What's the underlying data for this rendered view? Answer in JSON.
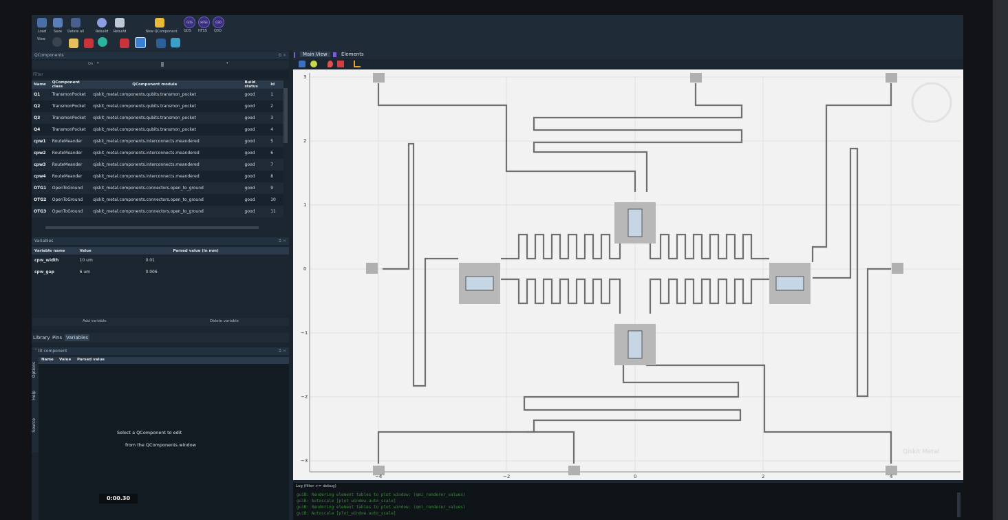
{
  "toolbar": {
    "row1": [
      {
        "label": "Load",
        "icon": "load-icon",
        "color": "#4a6fa8"
      },
      {
        "label": "Save",
        "icon": "save-icon",
        "color": "#5a7fb8"
      },
      {
        "label": "Delete all",
        "icon": "delete-all-icon",
        "color": "#4a5f90"
      },
      {
        "label": "Rebuild",
        "icon": "rebuild-icon",
        "color": "#8a9ee0"
      },
      {
        "label": "Rebuild",
        "icon": "rebuild-all-icon",
        "color": "#c0c8d8"
      },
      {
        "label": "New QComponent",
        "icon": "new-qcomponent-icon",
        "color": "#e8b93a"
      }
    ],
    "round_buttons": [
      "GDS",
      "HFSS",
      "Q3D"
    ],
    "round_labels": [
      "GDS",
      "HFSS",
      "Q3D"
    ],
    "view_label": "View"
  },
  "qcomponents": {
    "title": "QComponents",
    "filter_value": "On",
    "filter_placeholder": "Filter",
    "columns": [
      "Name",
      "QComponent class",
      "QComponent module",
      "Build status",
      "Id"
    ],
    "rows": [
      [
        "Q1",
        "TransmonPocket",
        "qiskit_metal.components.qubits.transmon_pocket",
        "good",
        "1"
      ],
      [
        "Q2",
        "TransmonPocket",
        "qiskit_metal.components.qubits.transmon_pocket",
        "good",
        "2"
      ],
      [
        "Q3",
        "TransmonPocket",
        "qiskit_metal.components.qubits.transmon_pocket",
        "good",
        "3"
      ],
      [
        "Q4",
        "TransmonPocket",
        "qiskit_metal.components.qubits.transmon_pocket",
        "good",
        "4"
      ],
      [
        "cpw1",
        "RouteMeander",
        "qiskit_metal.components.interconnects.meandered",
        "good",
        "5"
      ],
      [
        "cpw2",
        "RouteMeander",
        "qiskit_metal.components.interconnects.meandered",
        "good",
        "6"
      ],
      [
        "cpw3",
        "RouteMeander",
        "qiskit_metal.components.interconnects.meandered",
        "good",
        "7"
      ],
      [
        "cpw4",
        "RouteMeander",
        "qiskit_metal.components.interconnects.meandered",
        "good",
        "8"
      ],
      [
        "OTG1",
        "OpenToGround",
        "qiskit_metal.components.connectors.open_to_ground",
        "good",
        "9"
      ],
      [
        "OTG2",
        "OpenToGround",
        "qiskit_metal.components.connectors.open_to_ground",
        "good",
        "10"
      ],
      [
        "OTG3",
        "OpenToGround",
        "qiskit_metal.components.connectors.open_to_ground",
        "good",
        "11"
      ]
    ]
  },
  "variables": {
    "title": "Variables",
    "columns": [
      "Variable name",
      "Value",
      "Parsed value (in mm)"
    ],
    "rows": [
      [
        "cpw_width",
        "10 um",
        "0.01"
      ],
      [
        "cpw_gap",
        "6 um",
        "0.006"
      ]
    ],
    "add_label": "Add variable",
    "delete_label": "Delete variable"
  },
  "left_tabs": [
    "Library",
    "Pins",
    "Variables"
  ],
  "edit_component": {
    "title": "Edit component",
    "columns": [
      "Name",
      "Value",
      "Parsed value"
    ],
    "message_line1": "Select a QComponent to edit",
    "message_line2": "from the QComponents window",
    "side_tabs": [
      "Source",
      "Help",
      "Options"
    ]
  },
  "timer": "0:00.30",
  "plot": {
    "tabs": [
      "Main View",
      "Elements"
    ],
    "yticks": [
      "3",
      "2",
      "1",
      "0",
      "−1",
      "−2",
      "−3"
    ],
    "xticks": [
      "−4",
      "−2",
      "0",
      "2",
      "4"
    ],
    "watermark": "Qiskit Metal"
  },
  "log": {
    "title": "Log  (filter >= debug)",
    "lines": [
      "guiB: Rendering element tables to plot window: (qmi_renderer_values)",
      "guiB: Autoscale [plot_window.auto_scale]",
      "guiB: Rendering element tables to plot window: (qmi_renderer_values)",
      "guiB: Autoscale [plot_window.auto_scale]"
    ]
  }
}
